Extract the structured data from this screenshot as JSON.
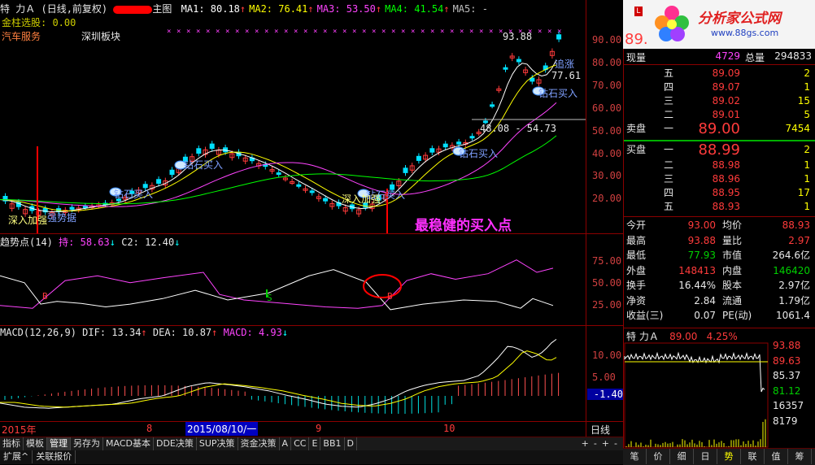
{
  "header": {
    "stock": "特  力Ａ",
    "mode": "(日线,前复权)",
    "main_chart_label": "主图",
    "ma": [
      {
        "label": "MA1:",
        "value": "80.18",
        "color": "#ffffff"
      },
      {
        "label": "MA2:",
        "value": "76.41",
        "color": "#ffff00"
      },
      {
        "label": "MA3:",
        "value": "53.50",
        "color": "#ff44ff"
      },
      {
        "label": "MA4:",
        "value": "41.54",
        "color": "#00ff00"
      },
      {
        "label": "MA5:",
        "value": "-",
        "color": "#c0c0c0"
      }
    ],
    "line2": "金柱选股: 0.00",
    "sector1": "汽车服务",
    "sector2": "深圳板块"
  },
  "main_chart": {
    "price_ticks": [
      "90.00",
      "80.00",
      "70.00",
      "60.00",
      "50.00",
      "40.00",
      "30.00",
      "20.00"
    ],
    "high_label": "93.88",
    "cur_label": "77.61",
    "chase_label": "追涨",
    "level_label": "48.08 - 54.73",
    "annotations": [
      "钻石买入",
      "钻石买入",
      "钻石买入",
      "钻石买入",
      "乘势而上",
      "深入加强",
      "深入加强",
      "钻石买入",
      "强势据",
      "追涨"
    ],
    "diamond_labels": [
      "钻石买入",
      "钻石买入",
      "钻石买入",
      "钻石买入",
      "钻石买入"
    ],
    "jinru": "深入加强",
    "qiangshi": "强势据",
    "best_buy": "最稳健的买入点"
  },
  "trend_panel": {
    "title": "趋势点(14)",
    "chi_label": "持:",
    "chi_value": "58.63",
    "c2_label": "C2:",
    "c2_value": "12.40",
    "ticks": [
      "75.00",
      "50.00",
      "25.00"
    ],
    "markers": [
      "B",
      "S",
      "B"
    ]
  },
  "macd_panel": {
    "title": "MACD(12,26,9)",
    "dif_label": "DIF:",
    "dif_value": "13.34",
    "dea_label": "DEA:",
    "dea_value": "10.87",
    "macd_label": "MACD:",
    "macd_value": "4.93",
    "ticks": [
      "10.00",
      "5.00"
    ],
    "cursor_value": "-1.40"
  },
  "date_axis": {
    "year": "2015年",
    "months": [
      "8",
      "9",
      "10"
    ],
    "selected_date": "2015/08/10/一",
    "period": "日线"
  },
  "toolbar": [
    "指标",
    "模板",
    "管理",
    "另存为",
    "MACD基本",
    "DDE决策",
    "SUP决策",
    "资金决策",
    "A",
    "CC",
    "E",
    "BB1",
    "D"
  ],
  "toolbar_right": [
    "+",
    "-",
    "+",
    "-"
  ],
  "toolbar2": [
    "扩展^",
    "关联报价"
  ],
  "right_panel": {
    "logo_text": "分析家公式网",
    "logo_url": "www.88gs.com",
    "price_top": "89.",
    "xianliang_label": "现量",
    "xianliang": "4729",
    "zongliang_label": "总量",
    "zongliang": "294833",
    "sell": [
      {
        "label": "五",
        "price": "89.09",
        "vol": "2"
      },
      {
        "label": "四",
        "price": "89.07",
        "vol": "1"
      },
      {
        "label": "三",
        "price": "89.02",
        "vol": "15"
      },
      {
        "label": "二",
        "price": "89.01",
        "vol": "5"
      },
      {
        "label": "一",
        "price": "89.00",
        "vol": "7454"
      }
    ],
    "sell_title": "卖盘",
    "buy_title": "买盘",
    "buy": [
      {
        "label": "一",
        "price": "88.99",
        "vol": "2"
      },
      {
        "label": "二",
        "price": "88.98",
        "vol": "1"
      },
      {
        "label": "三",
        "price": "88.96",
        "vol": "1"
      },
      {
        "label": "四",
        "price": "88.95",
        "vol": "17"
      },
      {
        "label": "五",
        "price": "88.93",
        "vol": "1"
      }
    ],
    "stats": [
      [
        {
          "k": "今开",
          "v": "93.00",
          "c": "#ff3b3b"
        },
        {
          "k": "均价",
          "v": "88.93",
          "c": "#ff3b3b"
        }
      ],
      [
        {
          "k": "最高",
          "v": "93.88",
          "c": "#ff3b3b"
        },
        {
          "k": "量比",
          "v": "2.97",
          "c": "#ff3b3b"
        }
      ],
      [
        {
          "k": "最低",
          "v": "77.93",
          "c": "#00d000"
        },
        {
          "k": "市值",
          "v": "264.6亿",
          "c": "#e8e8e8"
        }
      ],
      [
        {
          "k": "外盘",
          "v": "148413",
          "c": "#ff3b3b"
        },
        {
          "k": "内盘",
          "v": "146420",
          "c": "#00d000"
        }
      ],
      [
        {
          "k": "换手",
          "v": "16.44%",
          "c": "#e8e8e8"
        },
        {
          "k": "股本",
          "v": "2.97亿",
          "c": "#e8e8e8"
        }
      ],
      [
        {
          "k": "净资",
          "v": "2.84",
          "c": "#e8e8e8"
        },
        {
          "k": "流通",
          "v": "1.79亿",
          "c": "#e8e8e8"
        }
      ],
      [
        {
          "k": "收益(三)",
          "v": "0.07",
          "c": "#e8e8e8"
        },
        {
          "k": "PE(动)",
          "v": "1061.4",
          "c": "#e8e8e8"
        }
      ]
    ],
    "mini_title_stock": "特  力Ａ",
    "mini_price": "89.00",
    "mini_pct": "4.25%",
    "mini_ticks": [
      "93.88",
      "89.63",
      "85.37",
      "81.12",
      "16357",
      "8179"
    ],
    "tabs": [
      "笔",
      "价",
      "细",
      "日",
      "势",
      "联",
      "值",
      "筹"
    ]
  },
  "colors": {
    "up": "#ff3b3b",
    "down": "#00ffff",
    "border": "#8b0000",
    "ma1": "#ffffff",
    "ma2": "#ffff00",
    "ma3": "#ff44ff",
    "ma4": "#00ff00"
  }
}
